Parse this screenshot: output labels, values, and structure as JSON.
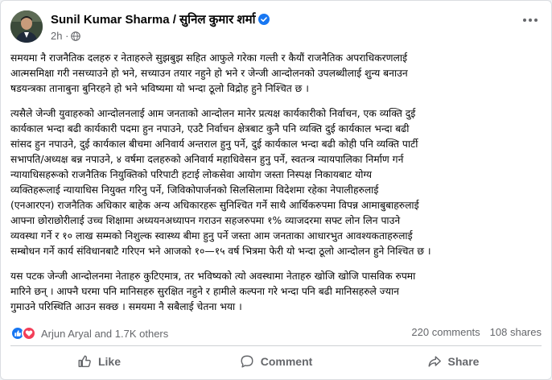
{
  "post": {
    "author": "Sunil Kumar Sharma / सुनिल कुमार शर्मा",
    "time": "2h",
    "time_separator": "·",
    "verified_icon": "verified-badge-icon",
    "privacy_icon": "globe-icon",
    "paragraphs": [
      "समयमा नै राजनैतिक दलहरु र नेताहरुले सुझबुझ सहित आफुले गरेका गल्ती र कैयौं राजनैतिक अपराधिकरणलाई\nआत्मसमिक्षा गरी नसच्याउने हो भने, सच्याउन तयार नहुने हो भने र जेन्जी आन्दोलनको उपलब्धीलाई शुन्य बनाउन\nषडयन्त्रका तानाबुना बुनिरहने हो भने भविष्यमा यो भन्दा ठूलो विद्रोह हुने निश्चित छ ।",
      "त्यसैले जेन्जी युवाहरुको आन्दोलनलाई आम जनताको आन्दोलन मानेर प्रत्यक्ष कार्यकारीको निर्वाचन, एक व्यक्ति दुई\nकार्यकाल भन्दा बढी कार्यकारी पदमा हुन नपाउने, एउटै निर्वाचन क्षेत्रबाट कुनै पनि व्यक्ति दुई कार्यकाल भन्दा बढी\nसांसद हुन नपाउने, दुई कार्यकाल बीचमा अनिवार्य अन्तराल हुनु पर्ने, दुई कार्यकाल भन्दा बढी कोही पनि व्यक्ति पार्टी\nसभापति/अध्यक्ष बन्न नपाउने, ४ वर्षमा दलहरुको अनिवार्य महाधिवेसन हुनु पर्ने, स्वतन्त्र न्यायपालिका निर्माण गर्न\nन्यायाधिसहरूको राजनैतिक नियुक्तिको परिपाटी हटाई लोकसेवा आयोग जस्ता निस्पक्ष निकायबाट योग्य\nव्यक्तिहरूलाई न्यायाधिस नियुक्त गरिनु पर्ने, जिविकोपार्जनको सिलसिलामा विदेशमा रहेका नेपालीहरुलाई\n(एनआरएन) राजनैतिक अधिकार बाहेक अन्य अधिकारहरू सुनिश्चित गर्ने साथै आर्थिकरुपमा विपन्न आमाबुबाहरुलाई\nआफ्ना छोराछोरीलाई उच्च शिक्षामा अध्ययनअध्यापन गराउन सहजरुपमा १% व्याजदरमा सफ्ट लोन लिन पाउने\nव्यवस्था गर्ने र १० लाख सम्मको निशुल्क स्वास्थ्य बीमा हुनु पर्ने जस्ता आम जनताका आधारभुत आवश्यकताहरुलाई\nसम्बोधन गर्ने कार्य संविधानबाटै गरिएन भने आजको १०—१५ वर्ष भित्रमा फेरी यो भन्दा ठूलो आन्दोलन हुने निश्चित छ ।",
      "यस पटक जेन्जी आन्दोलनमा नेताहरु कुटिएमात्र, तर भविष्यको त्यो अवस्थामा नेताहरु खोजि खोजि पासविक रुपमा\nमारिने छन् । आफ्नै घरमा पनि मानिसहरु सुरक्षित नहुने र हामीले कल्पना गरे भन्दा पनि बढी मानिसहरुले ज्यान\nगुमाउने परिस्थिति आउन सक्छ । समयमा नै सबैलाई चेतना भया ।"
    ]
  },
  "engagement": {
    "reactions_text": "Arjun Aryal and 1.7K others",
    "comments": "220 comments",
    "shares": "108 shares"
  },
  "actions": {
    "like": "Like",
    "comment": "Comment",
    "share": "Share"
  },
  "colors": {
    "accent": "#1877f2",
    "love": "#f33e58",
    "muted": "#65676b"
  }
}
